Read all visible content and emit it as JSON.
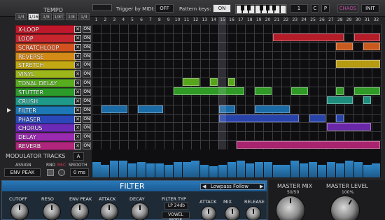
{
  "topbar": {
    "tempo_label": "TEMPO",
    "tempo_options": [
      "1/4",
      "1/16",
      "1/8",
      "1/8T",
      "1/8",
      "1/4"
    ],
    "tempo_selected_index": 1,
    "trigger_label": "Trigger by MIDI:",
    "trigger_value": "OFF",
    "pattern_keys_label": "Pattern keys:",
    "pattern_keys_value": "ON",
    "pattern_number": "1",
    "c_button": "C",
    "p_button": "P",
    "chaos_button": "CHAOS",
    "init_button": "INIT"
  },
  "columns": [
    "1",
    "2",
    "3",
    "4",
    "5",
    "6",
    "7",
    "8",
    "9",
    "10",
    "11",
    "12",
    "13",
    "14",
    "15",
    "16",
    "17",
    "18",
    "19",
    "20",
    "21",
    "22",
    "23",
    "24",
    "25",
    "26",
    "27",
    "28",
    "29",
    "30",
    "31",
    "32"
  ],
  "tracks": [
    {
      "name": "X-LOOP",
      "color": "#c0182a",
      "toggle": "ON"
    },
    {
      "name": "LOOP",
      "color": "#c7262e",
      "toggle": "ON"
    },
    {
      "name": "SCRATCHLOOP",
      "color": "#d2521f",
      "toggle": "ON"
    },
    {
      "name": "REVERSE",
      "color": "#d48a16",
      "toggle": "ON"
    },
    {
      "name": "STRETCH",
      "color": "#c2a813",
      "toggle": "ON"
    },
    {
      "name": "VINYL",
      "color": "#9db61a",
      "toggle": "ON"
    },
    {
      "name": "TONAL DELAY",
      "color": "#58ad1f",
      "toggle": "ON"
    },
    {
      "name": "STUTTER",
      "color": "#2c9b2a",
      "toggle": "ON"
    },
    {
      "name": "CRUSH",
      "color": "#1f9a8a",
      "toggle": "ON"
    },
    {
      "name": "FILTER",
      "color": "#1c78b6",
      "toggle": "ON"
    },
    {
      "name": "PHASER",
      "color": "#2a48b8",
      "toggle": "ON"
    },
    {
      "name": "CHORUS",
      "color": "#6d2ab6",
      "toggle": "ON"
    },
    {
      "name": "DELAY",
      "color": "#9a2ab0",
      "toggle": "ON"
    },
    {
      "name": "REVERB",
      "color": "#b0267c",
      "toggle": "ON"
    }
  ],
  "active_track_index": 9,
  "playhead_step": 15,
  "blocks": [
    {
      "track": 1,
      "start": 21,
      "end": 28,
      "color": "#b41c28"
    },
    {
      "track": 1,
      "start": 30,
      "end": 32,
      "color": "#b41c28"
    },
    {
      "track": 2,
      "start": 28,
      "end": 29,
      "color": "#c75a1c"
    },
    {
      "track": 2,
      "start": 31,
      "end": 32,
      "color": "#c75a1c"
    },
    {
      "track": 4,
      "start": 28,
      "end": 32,
      "color": "#b59a12"
    },
    {
      "track": 6,
      "start": 11,
      "end": 12,
      "color": "#57a51a"
    },
    {
      "track": 6,
      "start": 14,
      "end": 14,
      "color": "#57a51a"
    },
    {
      "track": 6,
      "start": 16,
      "end": 16,
      "color": "#57a51a"
    },
    {
      "track": 7,
      "start": 10,
      "end": 17,
      "color": "#2f9a26"
    },
    {
      "track": 7,
      "start": 19,
      "end": 20,
      "color": "#2f9a26"
    },
    {
      "track": 7,
      "start": 23,
      "end": 24,
      "color": "#2f9a26"
    },
    {
      "track": 7,
      "start": 28,
      "end": 28,
      "color": "#2f9a26"
    },
    {
      "track": 7,
      "start": 30,
      "end": 32,
      "color": "#2f9a26"
    },
    {
      "track": 8,
      "start": 27,
      "end": 29,
      "color": "#1d8c7c"
    },
    {
      "track": 8,
      "start": 31,
      "end": 31,
      "color": "#1d8c7c"
    },
    {
      "track": 9,
      "start": 2,
      "end": 4,
      "color": "#1a6aa6"
    },
    {
      "track": 9,
      "start": 6,
      "end": 8,
      "color": "#1a6aa6"
    },
    {
      "track": 9,
      "start": 15,
      "end": 16,
      "color": "#1a6aa6"
    },
    {
      "track": 9,
      "start": 19,
      "end": 22,
      "color": "#1a6aa6"
    },
    {
      "track": 10,
      "start": 15,
      "end": 23,
      "color": "#2742a8"
    },
    {
      "track": 10,
      "start": 25,
      "end": 26,
      "color": "#2742a8"
    },
    {
      "track": 10,
      "start": 28,
      "end": 28,
      "color": "#2742a8"
    },
    {
      "track": 11,
      "start": 27,
      "end": 31,
      "color": "#6a28a8"
    },
    {
      "track": 13,
      "start": 17,
      "end": 32,
      "color": "#a8246e"
    }
  ],
  "modulator": {
    "label": "MODULATOR TRACKS",
    "track": "A",
    "assign_label": "ASSIGN",
    "rnd_label": "RND",
    "rec_label": "REC",
    "smooth_label": "SMOOTH",
    "target": "ENV PEAK",
    "smooth_value": "0 ms",
    "levels": [
      0.55,
      0.45,
      0.6,
      0.6,
      0.5,
      0.55,
      0.5,
      0.5,
      0.45,
      0.55,
      0.55,
      0.6,
      0.45,
      0.4,
      0.45,
      0.55,
      0.6,
      0.5,
      0.55,
      0.55,
      0.45,
      0.45,
      0.6,
      0.5,
      0.55,
      0.45,
      0.55,
      0.5,
      0.6,
      0.55,
      0.45,
      0.5
    ]
  },
  "filter_panel": {
    "title": "FILTER",
    "preset": "Lowpass Follow",
    "prev_icon": "triangle-left",
    "next_icon": "triangle-right",
    "knobs": [
      "CUTOFF",
      "RESO",
      "ENV PEAK",
      "ATTACK",
      "DECAY"
    ],
    "filter_type_label": "FILTER TYP",
    "filter_type_value": "LP 24db",
    "vowel_mode": "VOWEL MODE",
    "right_knobs": [
      "ATTACK",
      "MIX",
      "RELEASE"
    ]
  },
  "master": {
    "mix_label": "MASTER MIX",
    "mix_value": "50/50",
    "level_label": "MASTER LEVEL",
    "level_value": "100%"
  },
  "colors": {
    "accent": "#1c78b6",
    "panel": "#242427"
  }
}
